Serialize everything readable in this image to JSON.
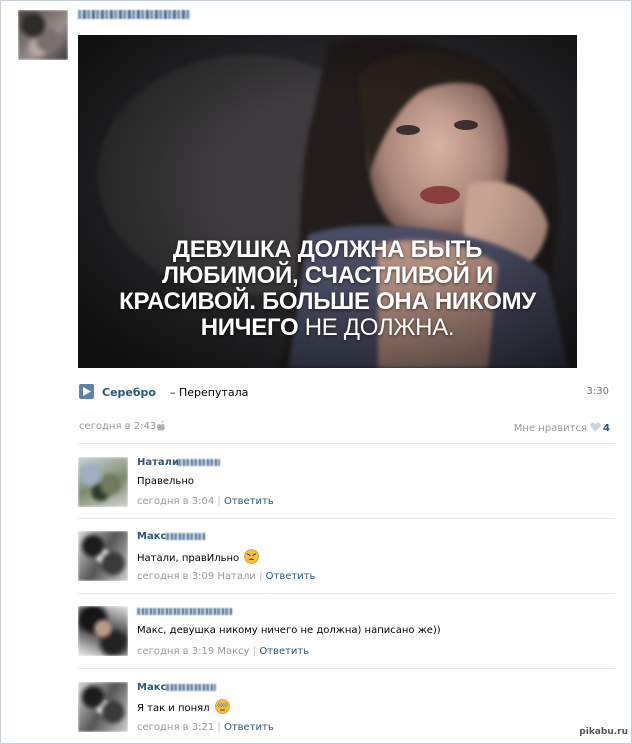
{
  "post": {
    "quote": {
      "line1": "ДЕВУШКА ДОЛЖНА БЫТЬ",
      "line2": "ЛЮБИМОЙ, СЧАСТЛИВОЙ И",
      "line3": "КРАСИВОЙ. БОЛЬШЕ ОНА НИКОМУ",
      "line4_bold": "НИЧЕГО",
      "line4_thin": " НЕ ДОЛЖНА."
    },
    "audio": {
      "artist": "Серебро",
      "track": "– Перепутала",
      "duration": "3:30",
      "icon": "play-icon"
    },
    "time": "сегодня в 2:43",
    "device_icon": "apple-icon",
    "like_label": "Мне нравится",
    "like_icon": "heart-icon",
    "like_count": "4"
  },
  "comments": [
    {
      "name": "Натали",
      "text": "Правельно",
      "time": "сегодня в 3:04",
      "reply_to": "",
      "reply_label": "Ответить"
    },
    {
      "name": "Макс",
      "text": "Натали, правИльно",
      "emoji": "tired-face-emoji",
      "time": "сегодня в 3:09",
      "reply_to": "Натали",
      "reply_label": "Ответить"
    },
    {
      "name": "",
      "text": "Макс, девушка никому ничего не должна) написано же))",
      "time": "сегодня в 3:19",
      "reply_to": "Максу",
      "reply_label": "Ответить"
    },
    {
      "name": "Макс",
      "text": "Я так и понял",
      "emoji": "flushed-face-emoji",
      "time": "сегодня в 3:21",
      "reply_to": "",
      "reply_label": "Ответить"
    }
  ],
  "watermark": "pikabu.ru",
  "colors": {
    "link": "#2b587a",
    "meta": "#999999",
    "divider": "#e4e8ed",
    "play": "#5e82a8"
  }
}
